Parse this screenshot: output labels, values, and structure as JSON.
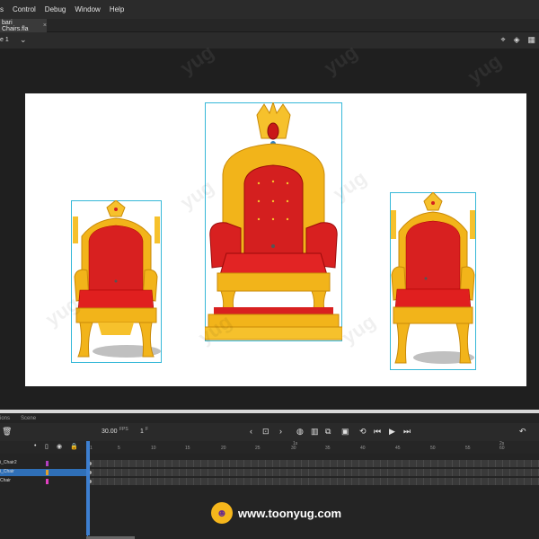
{
  "menubar": {
    "items": [
      "s",
      "Control",
      "Debug",
      "Window",
      "Help"
    ]
  },
  "document": {
    "tab_name": "bari Chairs.fla",
    "close_glyph": "×"
  },
  "scene": {
    "name": "e 1",
    "chevron": "⌄"
  },
  "scene_icons": [
    "crosshair-icon",
    "paint-bucket-icon",
    "grid-icon"
  ],
  "stage": {
    "background": "#ffffff",
    "selection_color": "#36b8d8",
    "objects": [
      "left-chair",
      "center-throne",
      "right-chair"
    ]
  },
  "watermark_text": "yug",
  "timeline": {
    "tabs": [
      "ions",
      "Scene"
    ],
    "fps": "30.00",
    "fps_label": "FPS",
    "frame": "1",
    "frame_label": "F",
    "ruler_marks": [
      "1",
      "5",
      "10",
      "15",
      "20",
      "25",
      "30",
      "35",
      "40",
      "45",
      "50",
      "55",
      "60"
    ],
    "ruler_seconds": [
      "1s",
      "2s"
    ],
    "layers": [
      {
        "name": "i_Chair2",
        "swatch": "#b040c0",
        "selected": false
      },
      {
        "name": "i_Chair",
        "swatch": "#e0a030",
        "selected": true
      },
      {
        "name": "Chair",
        "swatch": "#e040c0",
        "selected": false
      }
    ]
  },
  "badge": {
    "url": "www.toonyug.com"
  }
}
